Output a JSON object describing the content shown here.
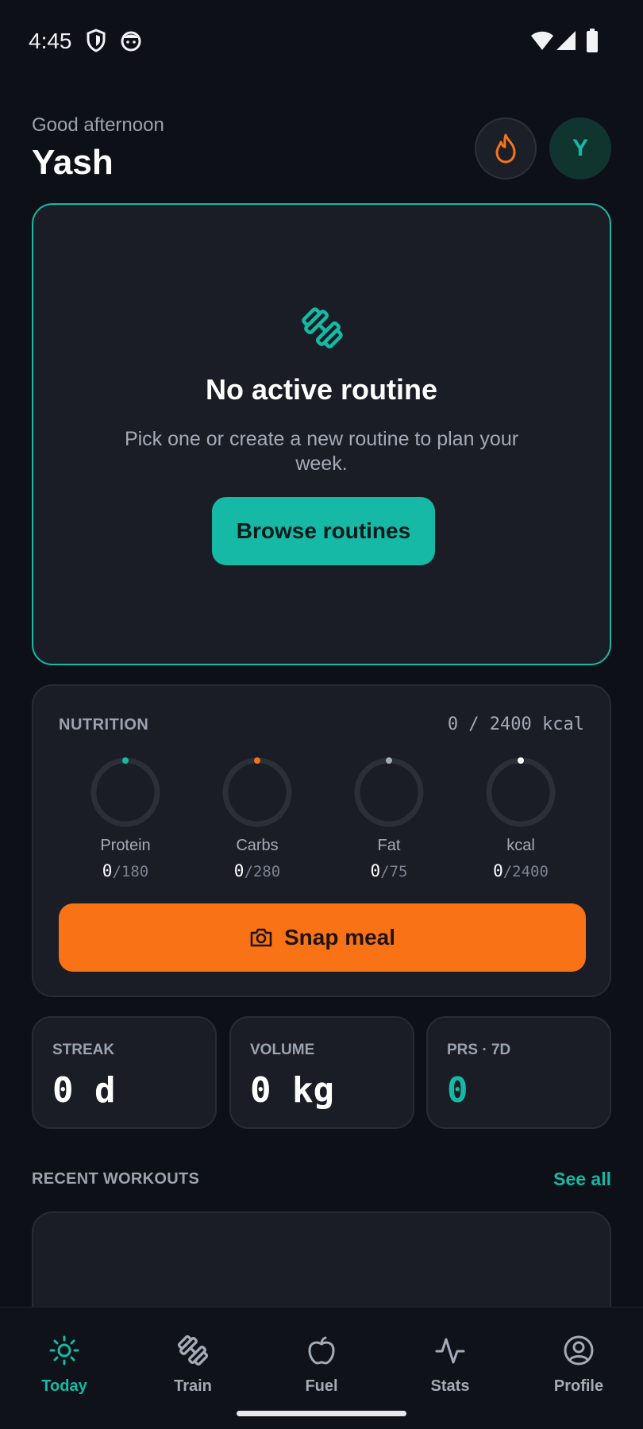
{
  "status_bar": {
    "time": "4:45"
  },
  "header": {
    "greeting": "Good afternoon",
    "name": "Yash",
    "avatar_initial": "Y"
  },
  "routine": {
    "title": "No active routine",
    "description": "Pick one or create a new routine to plan your week.",
    "button": "Browse routines"
  },
  "nutrition": {
    "label": "NUTRITION",
    "total": "0 / 2400 kcal",
    "macros": [
      {
        "label": "Protein",
        "value": "0",
        "target": "/180",
        "color": "#15b9a5"
      },
      {
        "label": "Carbs",
        "value": "0",
        "target": "/280",
        "color": "#f97316"
      },
      {
        "label": "Fat",
        "value": "0",
        "target": "/75",
        "color": "#a3abb8"
      },
      {
        "label": "kcal",
        "value": "0",
        "target": "/2400",
        "color": "#ffffff"
      }
    ],
    "snap_button": "Snap meal"
  },
  "stats": [
    {
      "label": "STREAK",
      "value": "0 d"
    },
    {
      "label": "VOLUME",
      "value": "0 kg"
    },
    {
      "label": "PRS · 7D",
      "value": "0"
    }
  ],
  "recent": {
    "label": "RECENT WORKOUTS",
    "see_all": "See all"
  },
  "nav": [
    {
      "label": "Today",
      "icon": "sun-icon",
      "active": true
    },
    {
      "label": "Train",
      "icon": "dumbbell-icon",
      "active": false
    },
    {
      "label": "Fuel",
      "icon": "apple-icon",
      "active": false
    },
    {
      "label": "Stats",
      "icon": "activity-icon",
      "active": false
    },
    {
      "label": "Profile",
      "icon": "user-circle-icon",
      "active": false
    }
  ],
  "colors": {
    "accent": "#15b9a5",
    "orange": "#f97316",
    "background": "#0d1016",
    "card": "#1a1d25"
  }
}
